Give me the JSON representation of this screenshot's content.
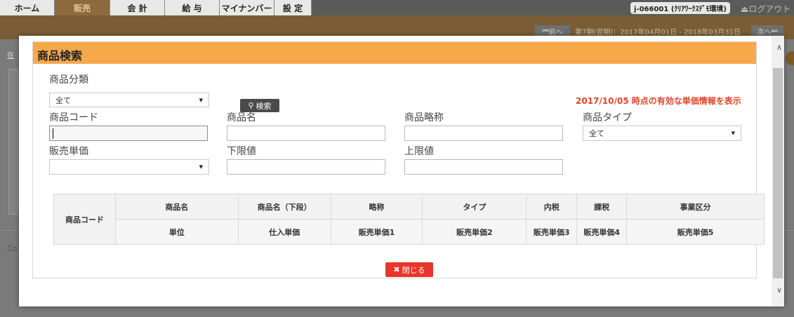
{
  "nav": {
    "tabs": [
      {
        "label": "ホーム",
        "active": false
      },
      {
        "label": "販売",
        "active": true
      },
      {
        "label": "会 計",
        "active": false
      },
      {
        "label": "給 与",
        "active": false
      },
      {
        "label": "マイナンバー",
        "active": false
      },
      {
        "label": "設 定",
        "active": false
      }
    ],
    "user": "j-066001 (ｸﾘｱﾜｰｸｽﾃﾞﾓ環境)",
    "logout": "ログアウト",
    "logout_icon": "eject-icon"
  },
  "period": {
    "prev_label": "前へ",
    "text": "第7期(翌期)：2017年04月01日 - 2018年03月31日",
    "next_label": "次へ"
  },
  "background": {
    "link_fragment": "在",
    "footer_fragment": "Co"
  },
  "dialog": {
    "title": "商品検索",
    "category_label": "商品分類",
    "category_value": "全て",
    "search_button": "検索",
    "date_note": "2017/10/05 時点の有効な単価情報を表示",
    "product_code_label": "商品コード",
    "product_code_value": "",
    "product_name_label": "商品名",
    "product_name_value": "",
    "product_short_label": "商品略称",
    "product_short_value": "",
    "product_type_label": "商品タイプ",
    "product_type_value": "全て",
    "sales_price_label": "販売単価",
    "sales_price_value": "",
    "lower_label": "下限値",
    "lower_value": "",
    "upper_label": "上限値",
    "upper_value": "",
    "close_button": "閉じる"
  },
  "table": {
    "code_header": "商品コード",
    "row1": [
      "商品名",
      "商品名（下段）",
      "略称",
      "タイプ",
      "内税",
      "課税",
      "事業区分"
    ],
    "row2": [
      "単位",
      "仕入単価",
      "販売単価1",
      "販売単価2",
      "販売単価3",
      "販売単価4",
      "販売単価5"
    ]
  },
  "colors": {
    "dialog_header": "#f7a84a",
    "date_note": "#e0452b",
    "close_button": "#e8352a",
    "search_button": "#4a4a4a"
  }
}
